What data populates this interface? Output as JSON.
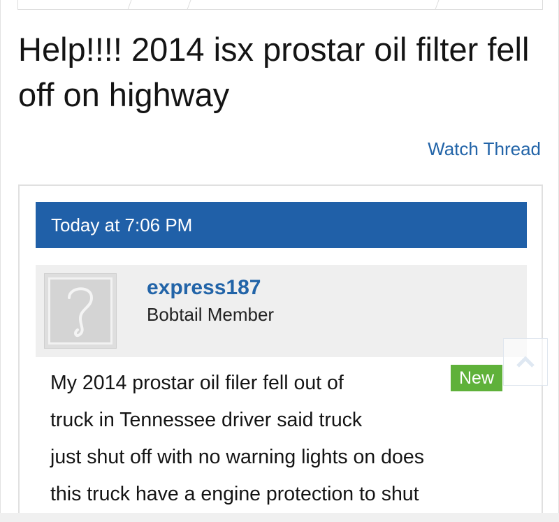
{
  "thread": {
    "title": "Help!!!! 2014 isx prostar oil filter fell off on highway",
    "watch_label": "Watch Thread"
  },
  "post": {
    "date": "Today at 7:06 PM",
    "username": "express187",
    "user_title": "Bobtail Member",
    "badge": "New",
    "message_lines": [
      "My 2014 prostar oil filer fell out of",
      "truck in Tennessee driver said truck",
      "just shut off with no warning lights on does",
      "this truck have a engine protection to shut"
    ]
  },
  "icons": {
    "avatar": "question-mark-placeholder",
    "scroll_top": "chevron-up-icon"
  },
  "colors": {
    "accent": "#2060a8",
    "link": "#2264a8",
    "badge": "#5fb13a"
  }
}
